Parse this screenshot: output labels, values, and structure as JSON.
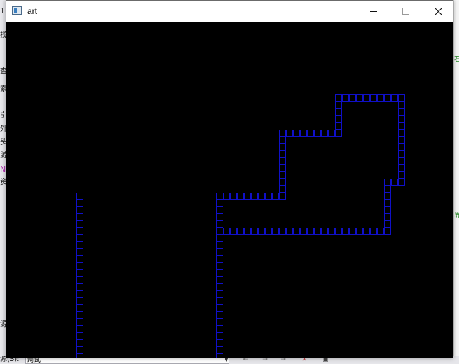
{
  "window": {
    "title": "art",
    "icon": "app-window-icon",
    "controls": [
      "minimize-icon",
      "maximize-icon",
      "close-icon"
    ]
  },
  "canvas": {
    "background_color": "#000000",
    "cell_stroke_color": "#1010c8",
    "columns": [
      {
        "col": 10,
        "row_from": 24,
        "row_to": 47
      },
      {
        "col": 30,
        "row_from": 24,
        "row_to": 47
      }
    ],
    "horizontal_runs": [
      {
        "row": 24,
        "col_from": 30,
        "col_to": 39
      },
      {
        "row": 29,
        "col_from": 30,
        "col_to": 54
      },
      {
        "row": 15,
        "col_from": 39,
        "col_to": 47
      },
      {
        "row": 10,
        "col_from": 47,
        "col_to": 56
      },
      {
        "row": 22,
        "col_from": 54,
        "col_to": 56
      }
    ],
    "vertical_runs": [
      {
        "col": 39,
        "row_from": 15,
        "row_to": 24
      },
      {
        "col": 47,
        "row_from": 10,
        "row_to": 15
      },
      {
        "col": 56,
        "row_from": 10,
        "row_to": 22
      },
      {
        "col": 54,
        "row_from": 22,
        "row_to": 29
      }
    ]
  },
  "background_ide": {
    "left_glyphs": [
      "1",
      "揽",
      "",
      "查",
      "索",
      "",
      "引",
      "外",
      "头",
      "源",
      "N",
      "资",
      "源"
    ],
    "right_glyphs": [
      "石",
      "界"
    ],
    "bottom_label": "源(S):",
    "bottom_field_value": "调试"
  }
}
